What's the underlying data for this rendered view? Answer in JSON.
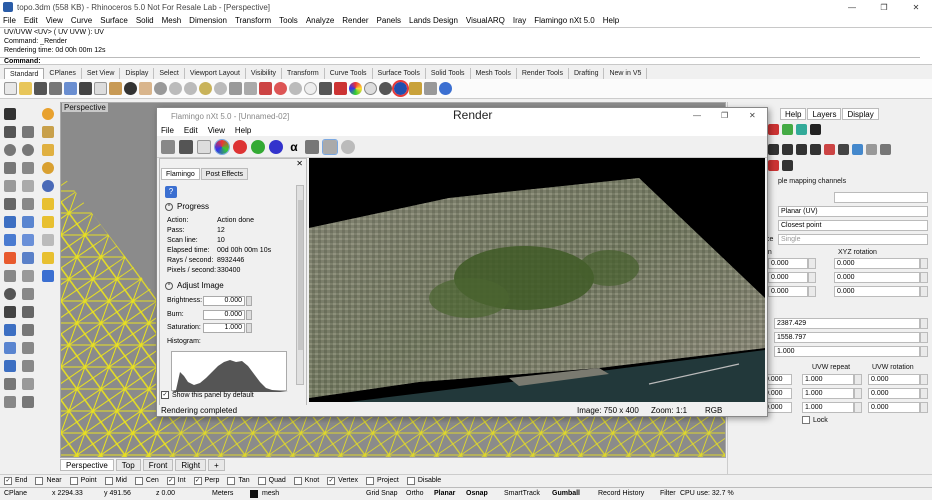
{
  "window": {
    "title": "topo.3dm (558 KB) - Rhinoceros 5.0 Not For Resale Lab - [Perspective]",
    "minimize": "—",
    "restore": "❐",
    "close": "✕"
  },
  "menu": [
    "File",
    "Edit",
    "View",
    "Curve",
    "Surface",
    "Solid",
    "Mesh",
    "Dimension",
    "Transform",
    "Tools",
    "Analyze",
    "Render",
    "Panels",
    "Lands Design",
    "VisualARQ",
    "Iray",
    "Flamingo nXt 5.0",
    "Help"
  ],
  "command_history": [
    "UV/UVW <UV> ( UV  UVW ): UV",
    "Command: _Render",
    "Rendering time: 0d 00h 00m 12s"
  ],
  "command_prompt": "Command:",
  "toolbar_tabs": [
    "Standard",
    "CPlanes",
    "Set View",
    "Display",
    "Select",
    "Viewport Layout",
    "Visibility",
    "Transform",
    "Curve Tools",
    "Surface Tools",
    "Solid Tools",
    "Mesh Tools",
    "Render Tools",
    "Drafting",
    "New in V5"
  ],
  "viewport": {
    "label": "Perspective",
    "tabs": [
      "Perspective",
      "Top",
      "Front",
      "Right"
    ],
    "add_tab": "+"
  },
  "right_panel": {
    "tabs": [
      "Help",
      "Layers",
      "Display"
    ],
    "mapping_heading": "ple mapping channels",
    "projection": "Planar (UV)",
    "sample": "Closest point",
    "space_label": "ce",
    "space_value": "Single",
    "rotation_label": "XYZ rotation",
    "position_label": "on",
    "position_values": [
      "0.000",
      "0.000",
      "0.000"
    ],
    "rotation_values": [
      "0.000",
      "0.000",
      "0.000"
    ],
    "size_values": [
      "2387.429",
      "1558.797",
      "1.000"
    ],
    "uvw_offset_label": "t",
    "uvw_repeat_label": "UVW repeat",
    "uvw_rotation_label": "UVW rotation",
    "offset_values": [
      "0.000",
      "0.000",
      "0.000"
    ],
    "repeat_values": [
      "1.000",
      "1.000",
      "1.000"
    ],
    "uvw_rot_values": [
      "0.000",
      "0.000",
      "0.000"
    ],
    "lock_label": "Lock"
  },
  "flamingo": {
    "title": "Flamingo nXt 5.0 - [Unnamed-02]",
    "render_label": "Render",
    "menu": [
      "File",
      "Edit",
      "View",
      "Help"
    ],
    "panel_tabs": [
      "Flamingo",
      "Post Effects"
    ],
    "progress_heading": "Progress",
    "progress": [
      {
        "k": "Action:",
        "v": "Action done"
      },
      {
        "k": "Pass:",
        "v": "12"
      },
      {
        "k": "Scan line:",
        "v": "10"
      },
      {
        "k": "Elapsed time:",
        "v": "00d 00h 00m 10s"
      },
      {
        "k": "Rays / second:",
        "v": "8932446"
      },
      {
        "k": "Pixels / second:",
        "v": "330400"
      }
    ],
    "adjust_heading": "Adjust Image",
    "adjust": [
      {
        "k": "Brightness:",
        "v": "0.000"
      },
      {
        "k": "Burn:",
        "v": "0.000"
      },
      {
        "k": "Saturation:",
        "v": "1.000"
      }
    ],
    "histogram_label": "Histogram:",
    "show_panel": "Show this panel by default",
    "status": "Rendering completed",
    "image_size": "Image: 750 x 400",
    "zoom": "Zoom: 1:1",
    "color_mode": "RGB"
  },
  "osnap": [
    "End",
    "Near",
    "Point",
    "Mid",
    "Cen",
    "Int",
    "Perp",
    "Tan",
    "Quad",
    "Knot",
    "Vertex",
    "Project",
    "Disable"
  ],
  "osnap_checked": [
    true,
    false,
    false,
    false,
    false,
    true,
    true,
    false,
    false,
    false,
    true,
    false,
    false
  ],
  "status": {
    "cplane": "CPlane",
    "x": "x 2294.33",
    "y": "y 491.56",
    "z": "z 0.00",
    "units": "Meters",
    "layer": "mesh",
    "grid_snap": "Grid Snap",
    "ortho": "Ortho",
    "planar": "Planar",
    "osnap": "Osnap",
    "smarttrack": "SmartTrack",
    "gumball": "Gumball",
    "record_history": "Record History",
    "filter": "Filter",
    "cpu": "CPU use: 32.7 %"
  },
  "colors": {
    "highlight": "#e53a3a",
    "mesh": "#e8e020",
    "viewport_bg": "#8b8b8b"
  }
}
